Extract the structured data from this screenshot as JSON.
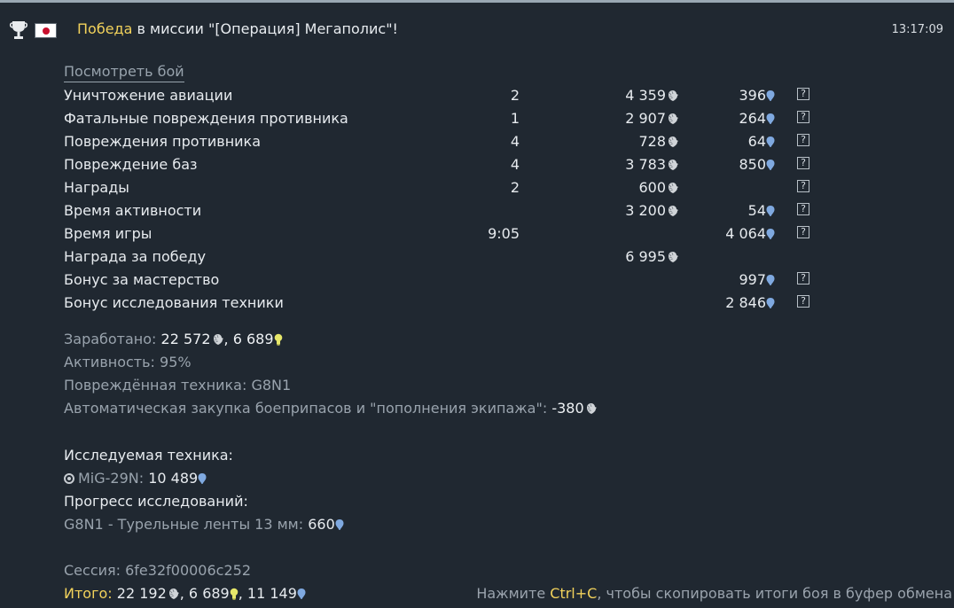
{
  "header": {
    "victory_word": "Победа",
    "mission_text": " в миссии \"[Операция] Мегаполис\"!",
    "time": "13:17:09"
  },
  "view_battle_link": "Посмотреть бой",
  "rows": [
    {
      "label": "Уничтожение авиации",
      "count": "2",
      "silver": "4 359",
      "rp": "396",
      "help": "?"
    },
    {
      "label": "Фатальные повреждения противника",
      "count": "1",
      "silver": "2 907",
      "rp": "264",
      "help": "?"
    },
    {
      "label": "Повреждения противника",
      "count": "4",
      "silver": "728",
      "rp": "64",
      "help": "?"
    },
    {
      "label": "Повреждение баз",
      "count": "4",
      "silver": "3 783",
      "rp": "850",
      "help": "?"
    },
    {
      "label": "Награды",
      "count": "2",
      "silver": "600",
      "rp": "",
      "help": "?"
    },
    {
      "label": "Время активности",
      "count": "",
      "silver": "3 200",
      "rp": "54",
      "help": "?"
    },
    {
      "label": "Время игры",
      "count": "9:05",
      "silver": "",
      "rp": "4 064",
      "help": "?"
    },
    {
      "label": "Награда за победу",
      "count": "",
      "silver": "6 995",
      "rp": "",
      "help": ""
    },
    {
      "label": "Бонус за мастерство",
      "count": "",
      "silver": "",
      "rp": "997",
      "help": "?"
    },
    {
      "label": "Бонус исследования техники",
      "count": "",
      "silver": "",
      "rp": "2 846",
      "help": "?"
    }
  ],
  "summary": {
    "earned_label": "Заработано: ",
    "earned_silver": "22 572",
    "earned_sep": ", ",
    "earned_crp": "6 689",
    "activity": "Активность: 95%",
    "damaged_label": "Повреждённая техника: ",
    "damaged_value": "G8N1",
    "autobuy_label": "Автоматическая закупка боеприпасов и \"пополнения экипажа\": ",
    "autobuy_value": "-380"
  },
  "research": {
    "researched_label": "Исследуемая техника:",
    "vehicle_name": "MiG-29N",
    "vehicle_sep": ": ",
    "vehicle_rp": "10 489",
    "progress_label": "Прогресс исследований:",
    "module_label": "G8N1 - Турельные ленты 13 мм: ",
    "module_rp": "660"
  },
  "session": "Сессия: 6fe32f00006c252",
  "total": {
    "label": "Итого:",
    "silver": " 22 192",
    "sep1": ", ",
    "crp": "6 689",
    "sep2": ", ",
    "rp": "11 149"
  },
  "hint": {
    "before": "Нажмите ",
    "keys": "Ctrl+C",
    "after": ", чтобы скопировать итоги боя в буфер обмена"
  },
  "colors": {
    "background": "#202831",
    "accent_yellow": "#f2d25b",
    "rp_blue": "#7fa9e0",
    "crp_yellow": "#e6e76a",
    "muted_text": "#99a3ad"
  },
  "icons": {
    "silver": "silver-lions-icon",
    "rp": "research-points-icon",
    "crp": "convertible-rp-icon",
    "trophy": "trophy-icon",
    "flag": "japan-flag-icon",
    "help": "help-icon",
    "target": "target-icon"
  }
}
